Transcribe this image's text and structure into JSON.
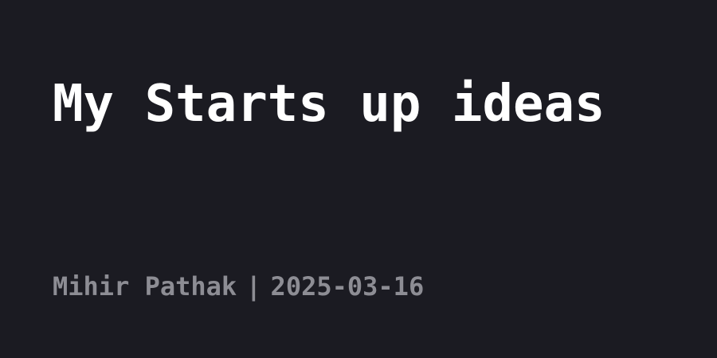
{
  "post": {
    "title": "My Starts up ideas",
    "author": "Mihir Pathak",
    "separator": "|",
    "date": "2025-03-16"
  },
  "colors": {
    "background": "#1b1b22",
    "title": "#ffffff",
    "byline": "#8d8d94"
  }
}
